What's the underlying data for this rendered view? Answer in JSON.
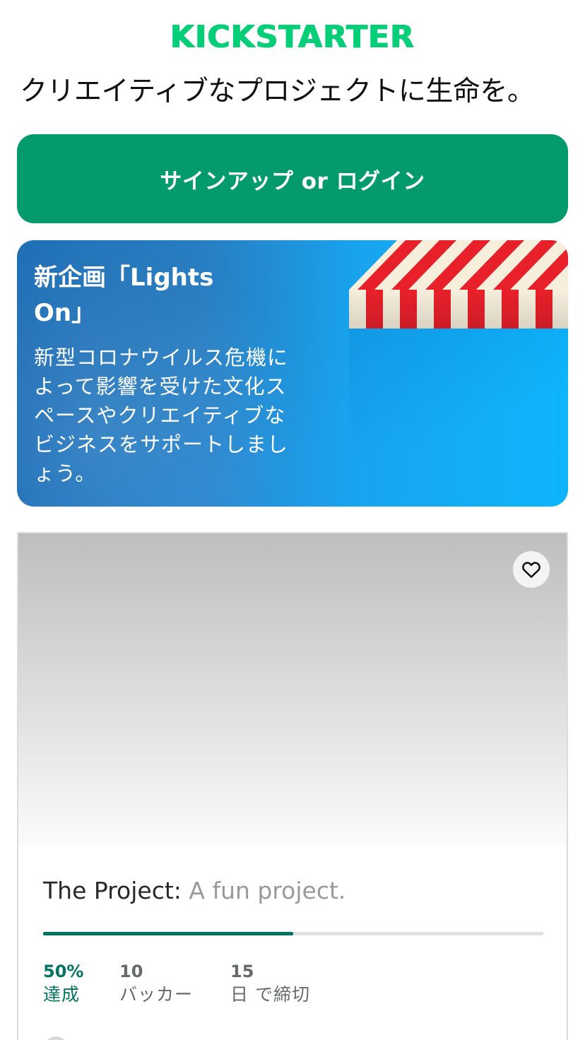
{
  "header": {
    "logo_text": "KICKSTARTER",
    "tagline": "クリエイティブなプロジェクトに生命を。"
  },
  "cta": {
    "label": "サインアップ or ログイン"
  },
  "banner": {
    "title": "新企画「Lights On」",
    "description": "新型コロナウイルス危機によって影響を受けた文化スペースやクリエイティブなビジネスをサポートしましょう。"
  },
  "project_card": {
    "name": "The Project:",
    "blurb": "A fun project.",
    "progress": 0.5,
    "stats": {
      "funded_value": "50%",
      "funded_label": "達成",
      "backers_value": "10",
      "backers_label": "バッカー",
      "days_value": "15",
      "days_label": "日 で締切"
    }
  },
  "colors": {
    "brand_green": "#05CE78",
    "cta_green": "#039B6E",
    "progress_green": "#037362",
    "banner_blue": "#0EB5FB"
  },
  "icons": {
    "favorite": "heart-outline-icon"
  }
}
